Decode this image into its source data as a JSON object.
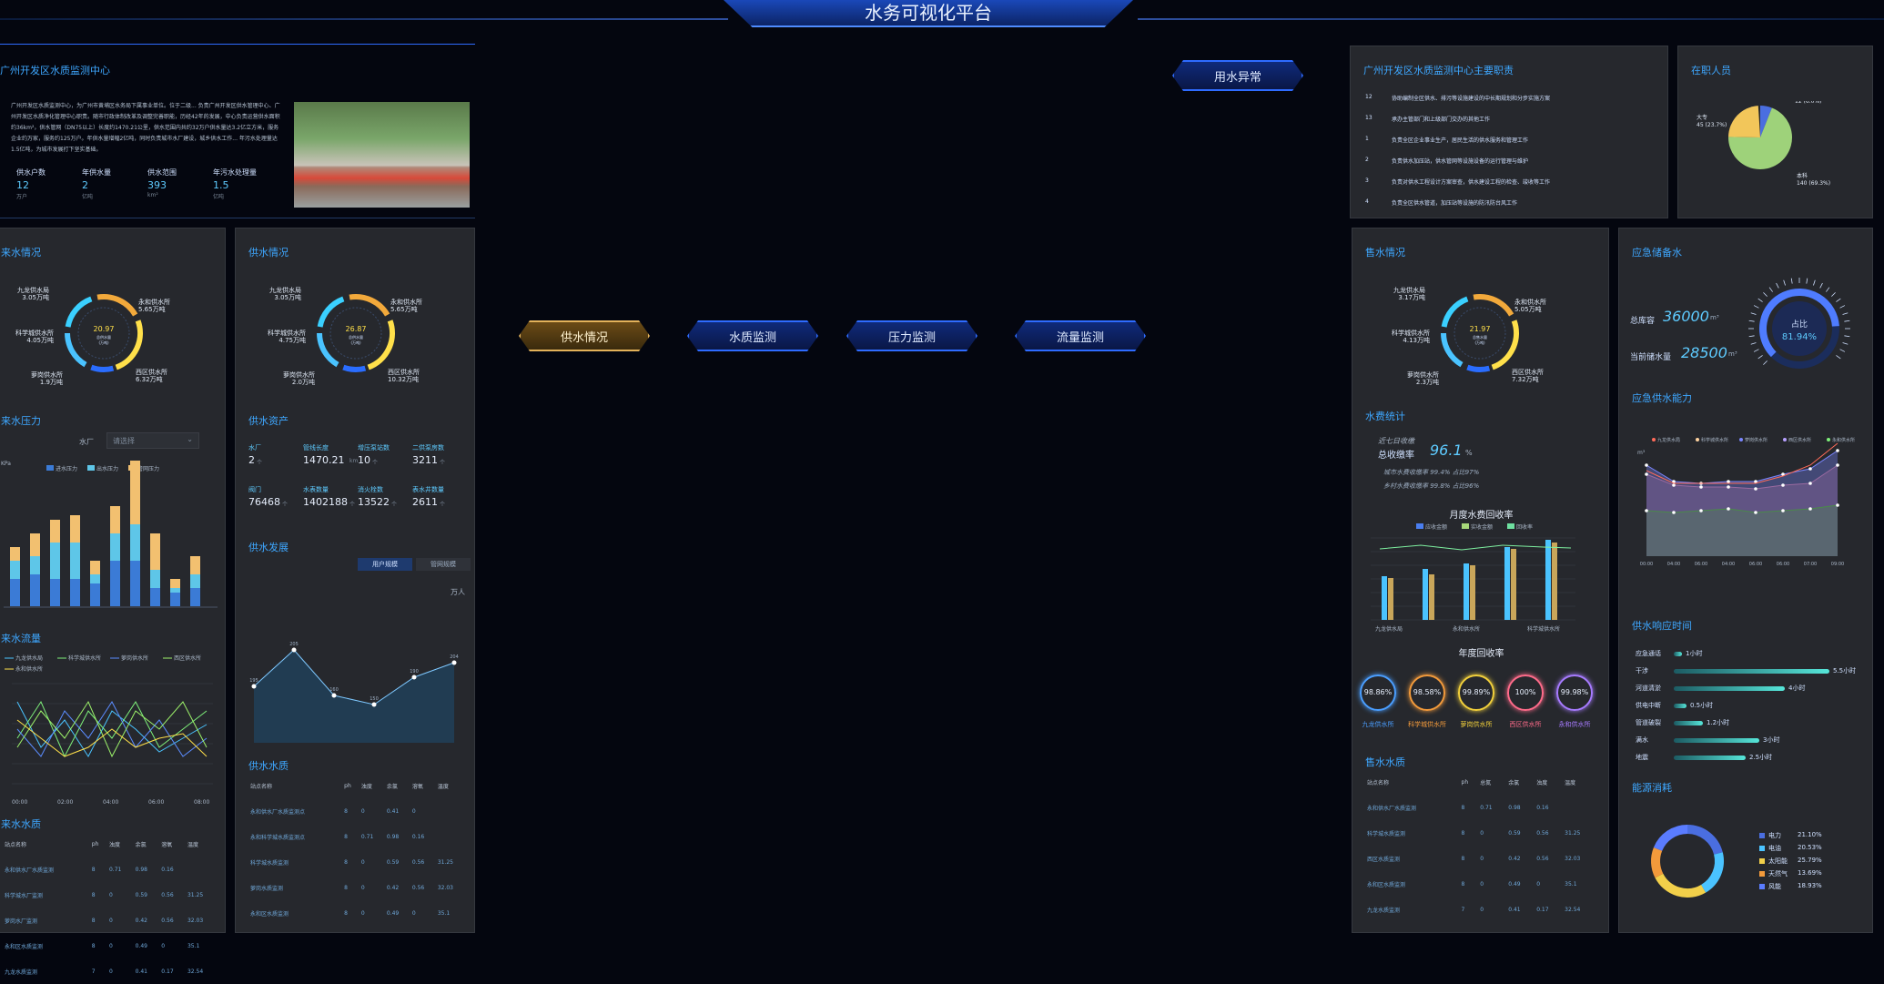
{
  "header": {
    "title": "水务可视化平台"
  },
  "alert_button": "用水异常",
  "nav": [
    {
      "label": "供水情况",
      "active": true
    },
    {
      "label": "水质监测",
      "active": false
    },
    {
      "label": "压力监测",
      "active": false
    },
    {
      "label": "流量监测",
      "active": false
    }
  ],
  "intro": {
    "title": "广州开发区水质监测中心",
    "text": "广州开发区水质监测中心，为广州市黄埔区水务局下属事业单位。位于二级... 负责广州开发区供水管理中心、广州开发区水质净化管理中心职责。随市行政体制改革及调整完善职能，历经42年的发展，中心负责运营供水面积约36km²，供水管网（DN75以上）长度约1470.21公里，供水范围内共约32万户供水量达3.2亿立方米，服务企业约万家，服务约125万户。年供水量增幅2亿吨，同时负责城市水厂建设，城乡供水工作... 年污水处理量达1.5亿吨，为城市发展打下坚实基础。",
    "stats": [
      {
        "label": "供水户数",
        "value": "12",
        "unit": "万户"
      },
      {
        "label": "年供水量",
        "value": "2",
        "unit": "亿吨"
      },
      {
        "label": "供水范围",
        "value": "393",
        "unit": "km²"
      },
      {
        "label": "年污水处理量",
        "value": "1.5",
        "unit": "亿吨"
      }
    ]
  },
  "left_col": {
    "supply1": {
      "title": "来水情况",
      "center_value": "20.97",
      "center_label": "总供水量",
      "center_unit": "(万吨)",
      "segments": [
        {
          "name": "九龙供水局",
          "value": "3.05万吨",
          "color": "#3ad0ff"
        },
        {
          "name": "永和供水所",
          "value": "5.65万吨",
          "color": "#f2a93b"
        },
        {
          "name": "西区供水所",
          "value": "6.32万吨",
          "color": "#ffe04a"
        },
        {
          "name": "萝岗供水所",
          "value": "1.9万吨",
          "color": "#2a6dff"
        },
        {
          "name": "科学城供水所",
          "value": "4.05万吨",
          "color": "#4ac3ff"
        }
      ]
    },
    "pressure": {
      "title": "来水压力",
      "filter_label": "水厂",
      "filter_placeholder": "请选择",
      "unit": "KPa",
      "legend": [
        "进水压力",
        "出水压力",
        "管网压力"
      ]
    },
    "flow": {
      "title": "来水流量",
      "legend": [
        "九龙供水局",
        "科学城供水所",
        "萝岗供水所",
        "西区供水所",
        "永和供水所"
      ],
      "x": [
        "00:00",
        "02:00",
        "04:00",
        "06:00",
        "08:00"
      ]
    },
    "quality": {
      "title": "来水水质",
      "headers": [
        "站点名称",
        "ph",
        "浊度",
        "余氯",
        "溶氧",
        "温度"
      ],
      "rows": [
        [
          "永和供水厂水质监测",
          "8",
          "0.71",
          "0.98",
          "0.16",
          ""
        ],
        [
          "科学城水厂监测",
          "8",
          "0",
          "0.59",
          "0.56",
          "31.25"
        ],
        [
          "萝岗水厂监测",
          "8",
          "0",
          "0.42",
          "0.56",
          "32.03"
        ],
        [
          "永和区水质监测",
          "8",
          "0",
          "0.49",
          "0",
          "35.1"
        ],
        [
          "九龙水质监测",
          "7",
          "0",
          "0.41",
          "0.17",
          "32.54"
        ]
      ]
    }
  },
  "col2": {
    "supply": {
      "title": "供水情况",
      "center_value": "26.87",
      "center_label": "总供水量",
      "center_unit": "(万吨)",
      "segments": [
        {
          "name": "九龙供水局",
          "value": "3.05万吨"
        },
        {
          "name": "永和供水所",
          "value": "5.65万吨"
        },
        {
          "name": "西区供水所",
          "value": "10.32万吨"
        },
        {
          "name": "萝岗供水所",
          "value": "2.0万吨"
        },
        {
          "name": "科学城供水所",
          "value": "4.75万吨"
        }
      ]
    },
    "assets": {
      "title": "供水资产",
      "items": [
        {
          "label": "水厂",
          "value": "2",
          "unit": "个"
        },
        {
          "label": "管线长度",
          "value": "1470.21",
          "unit": "km"
        },
        {
          "label": "增压泵站数",
          "value": "10",
          "unit": "个"
        },
        {
          "label": "二供泵房数",
          "value": "3211",
          "unit": "个"
        },
        {
          "label": "阀门",
          "value": "76468",
          "unit": "个"
        },
        {
          "label": "水表数量",
          "value": "1402188",
          "unit": "个"
        },
        {
          "label": "消火栓数",
          "value": "13522",
          "unit": "个"
        },
        {
          "label": "表水井数量",
          "value": "2611",
          "unit": "个"
        }
      ]
    },
    "growth": {
      "title": "供水发展",
      "tabs": [
        "用户规模",
        "管网规模"
      ],
      "unit": "万人"
    },
    "quality": {
      "title": "供水水质",
      "headers": [
        "站点名称",
        "ph",
        "浊度",
        "余氯",
        "溶氧",
        "温度"
      ],
      "rows": [
        [
          "永和供水厂水质监测点",
          "8",
          "0",
          "0.41",
          "0",
          ""
        ],
        [
          "永和科学城水质监测点",
          "8",
          "0.71",
          "0.98",
          "0.16",
          ""
        ],
        [
          "科学城水质监测",
          "8",
          "0",
          "0.59",
          "0.56",
          "31.25"
        ],
        [
          "萝岗水质监测",
          "8",
          "0",
          "0.42",
          "0.56",
          "32.03"
        ],
        [
          "永和区水质监测",
          "8",
          "0",
          "0.49",
          "0",
          "35.1"
        ]
      ]
    }
  },
  "duties": {
    "title": "广州开发区水质监测中心主要职责",
    "items": [
      {
        "n": "12",
        "text": "协助编制全区供水、排污等设施建设的中长期规划和分步实施方案"
      },
      {
        "n": "13",
        "text": "承办主管部门和上级部门交办的其他工作"
      },
      {
        "n": "1",
        "text": "负责全区企业事业生产，居民生活的供水服务和管理工作"
      },
      {
        "n": "2",
        "text": "负责供水加压站，供水管网等设施设备的运行管理与维护"
      },
      {
        "n": "3",
        "text": "负责对供水工程设计方案审查，供水建设工程的检查、竣收等工作"
      },
      {
        "n": "4",
        "text": "负责全区供水管道，加压站等设施的防汛防台风工作"
      }
    ]
  },
  "staff": {
    "title": "在职人员",
    "slices": [
      {
        "name": "研究生",
        "value": "12 (6.0%)",
        "color": "#4a6ee0"
      },
      {
        "name": "本科",
        "value": "140 (69.3%)",
        "color": "#9ed27a"
      },
      {
        "name": "大专",
        "value": "45 (23.7%)",
        "color": "#f2c65a"
      }
    ]
  },
  "sales": {
    "title": "售水情况",
    "center_value": "21.97",
    "center_label": "总售水量",
    "center_unit": "(万吨)",
    "segments": [
      {
        "name": "九龙供水局",
        "value": "3.17万吨"
      },
      {
        "name": "永和供水所",
        "value": "5.05万吨"
      },
      {
        "name": "西区供水所",
        "value": "7.32万吨"
      },
      {
        "name": "萝岗供水所",
        "value": "2.3万吨"
      },
      {
        "name": "科学城供水所",
        "value": "4.13万吨"
      }
    ],
    "fee": {
      "title": "水费统计",
      "period": "近七日收缴",
      "total_label": "总收缴率",
      "total_value": "96.1",
      "total_unit": "%",
      "lines": [
        "城市水费收缴率 99.4%  占比97%",
        "乡村水费收缴率 99.8%  占比96%"
      ]
    },
    "monthly": {
      "title": "月度水费回收率",
      "legend": [
        "应收金额",
        "实收金额",
        "回收率"
      ],
      "categories": [
        "九龙供水局",
        "永和供水所",
        "科学城供水所"
      ]
    },
    "annual": {
      "title": "年度回收率",
      "items": [
        {
          "value": "98.86%",
          "name": "九龙供水所",
          "color": "#4a9eff"
        },
        {
          "value": "98.58%",
          "name": "科学城供水所",
          "color": "#f29a3b"
        },
        {
          "value": "99.89%",
          "name": "萝岗供水所",
          "color": "#f2d03b"
        },
        {
          "value": "100%",
          "name": "西区供水所",
          "color": "#ff6b8a"
        },
        {
          "value": "99.98%",
          "name": "永和供水所",
          "color": "#a77bff"
        }
      ]
    },
    "quality": {
      "title": "售水水质",
      "headers": [
        "站点名称",
        "ph",
        "总氮",
        "余氯",
        "浊度",
        "温度"
      ],
      "rows": [
        [
          "永和供水厂水质监测",
          "8",
          "0.71",
          "0.98",
          "0.16",
          ""
        ],
        [
          "科学城水质监测",
          "8",
          "0",
          "0.59",
          "0.56",
          "31.25"
        ],
        [
          "西区水质监测",
          "8",
          "0",
          "0.42",
          "0.56",
          "32.03"
        ],
        [
          "永和区水质监测",
          "8",
          "0",
          "0.49",
          "0",
          "35.1"
        ],
        [
          "九龙水质监测",
          "7",
          "0",
          "0.41",
          "0.17",
          "32.54"
        ]
      ]
    }
  },
  "reserve": {
    "title": "应急储备水",
    "capacity_label": "总库容",
    "capacity_value": "36000",
    "capacity_unit": "m³",
    "current_label": "当前储水量",
    "current_value": "28500",
    "current_unit": "m³",
    "gauge_label": "占比",
    "gauge_value": "81.94%",
    "gauge_fraction": 0.8194
  },
  "capacity": {
    "title": "应急供水能力",
    "unit": "m³",
    "legend": [
      "九龙供水局",
      "科学城供水所",
      "萝岗供水所",
      "西区供水所",
      "永和供水所"
    ],
    "x": [
      "00:00",
      "04:00",
      "06:00",
      "04:00",
      "06:00",
      "06:00",
      "07:00",
      "09:00"
    ]
  },
  "response": {
    "title": "供水响应时间",
    "items": [
      {
        "label": "应急通话",
        "value": "1小时",
        "frac": 0.05
      },
      {
        "label": "干涉",
        "value": "5.5小时",
        "frac": 0.95
      },
      {
        "label": "河道清淤",
        "value": "4小时",
        "frac": 0.68
      },
      {
        "label": "供电中断",
        "value": "0.5小时",
        "frac": 0.08
      },
      {
        "label": "管道破裂",
        "value": "1.2小时",
        "frac": 0.18
      },
      {
        "label": "满水",
        "value": "3小时",
        "frac": 0.52
      },
      {
        "label": "地震",
        "value": "2.5小时",
        "frac": 0.44
      }
    ]
  },
  "energy": {
    "title": "能源消耗",
    "items": [
      {
        "name": "电力",
        "value": "21.10%",
        "color": "#4a6ee0"
      },
      {
        "name": "电油",
        "value": "20.53%",
        "color": "#4ac3ff"
      },
      {
        "name": "太阳能",
        "value": "25.79%",
        "color": "#f2d04a"
      },
      {
        "name": "天然气",
        "value": "13.69%",
        "color": "#f29a3b"
      },
      {
        "name": "风能",
        "value": "18.93%",
        "color": "#5a7cff"
      }
    ]
  }
}
